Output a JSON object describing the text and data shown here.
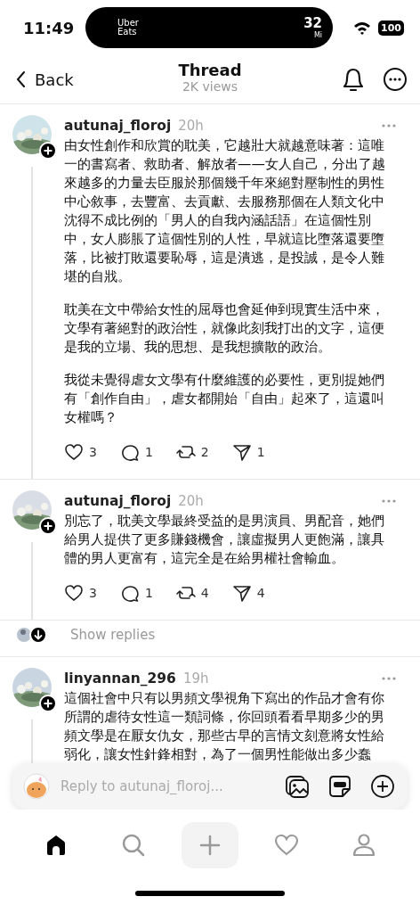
{
  "status_bar": {
    "time": "11:49",
    "live_activity": {
      "app_lines": [
        "Uber",
        "Eats"
      ],
      "value": "32",
      "unit": "Mi"
    },
    "battery": "100"
  },
  "nav": {
    "back": "Back",
    "title": "Thread",
    "subtitle": "2K views"
  },
  "posts": [
    {
      "username": "autunaj_floroj",
      "time": "20h",
      "avatar": {
        "kind": "picture"
      },
      "paragraphs": [
        "由女性創作和欣賞的耽美，它越壯大就越意味著：這唯一的書寫者、救助者、解放者——女人自己，分出了越來越多的力量去臣服於那個幾千年來絕對壓制性的男性中心敘事，去豐富、去貢獻、去服務那個在人類文化中沈得不成比例的「男人的自我內涵話語」在這個性別中，女人膨脹了這個性別的人性，早就這比墮落還要墮落，比被打敗還要恥辱，這是潰逃，是投誠，是令人難堪的自戕。",
        "耽美在文中帶給女性的屈辱也會延伸到現實生活中來，文學有著絕對的政治性，就像此刻我打出的文字，這便是我的立場、我的思想、是我想擴散的政治。",
        "我從未覺得虐女文學有什麼維護的必要性，更別提她們有「創作自由」，虐女都開始「自由」起來了，這還叫女權嗎？"
      ],
      "actions": {
        "likes": "3",
        "replies": "1",
        "reposts": "2",
        "shares": "1"
      }
    },
    {
      "username": "autunaj_floroj",
      "time": "20h",
      "avatar": {
        "kind": "picture"
      },
      "paragraphs": [
        "別忘了，耽美文學最終受益的是男演員、男配音，她們給男人提供了更多賺錢機會，讓虛擬男人更飽滿，讓具體的男人更富有，這完全是在給男權社會輸血。"
      ],
      "actions": {
        "likes": "3",
        "replies": "1",
        "reposts": "4",
        "shares": "4"
      },
      "show_replies": "Show replies"
    },
    {
      "username": "linyannan_296",
      "time": "19h",
      "avatar": {
        "kind": "picture"
      },
      "paragraphs": [
        "這個社會中只有以男頻文學視角下寫出的作品才會有你所謂的虐待女性這一類詞條，你回頭看看早期多少的男頻文學是在厭女仇女，那些古早的言情文刻意將女性給弱化，讓女性針鋒相對，為了一個男性能做出多少蠢"
      ]
    }
  ],
  "reply_bar": {
    "placeholder": "Reply to autunaj_floroj..."
  },
  "tab_bar": [
    {
      "kind": "home",
      "selected": true
    },
    {
      "kind": "search",
      "selected": false
    },
    {
      "kind": "create",
      "selected": false
    },
    {
      "kind": "activity",
      "selected": false
    },
    {
      "kind": "profile",
      "selected": false
    }
  ]
}
